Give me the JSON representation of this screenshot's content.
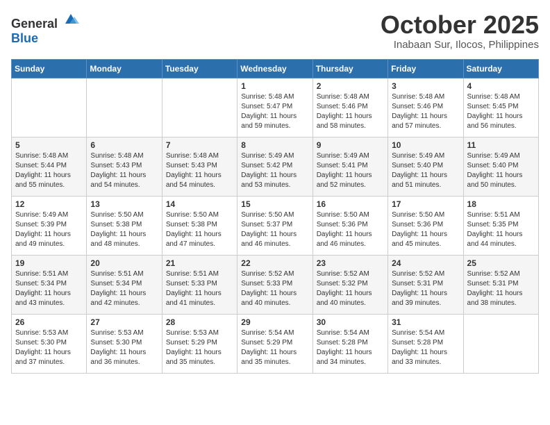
{
  "header": {
    "logo": {
      "text_general": "General",
      "text_blue": "Blue"
    },
    "title": "October 2025",
    "subtitle": "Inabaan Sur, Ilocos, Philippines"
  },
  "weekdays": [
    "Sunday",
    "Monday",
    "Tuesday",
    "Wednesday",
    "Thursday",
    "Friday",
    "Saturday"
  ],
  "weeks": [
    [
      {
        "day": "",
        "info": ""
      },
      {
        "day": "",
        "info": ""
      },
      {
        "day": "",
        "info": ""
      },
      {
        "day": "1",
        "info": "Sunrise: 5:48 AM\nSunset: 5:47 PM\nDaylight: 11 hours\nand 59 minutes."
      },
      {
        "day": "2",
        "info": "Sunrise: 5:48 AM\nSunset: 5:46 PM\nDaylight: 11 hours\nand 58 minutes."
      },
      {
        "day": "3",
        "info": "Sunrise: 5:48 AM\nSunset: 5:46 PM\nDaylight: 11 hours\nand 57 minutes."
      },
      {
        "day": "4",
        "info": "Sunrise: 5:48 AM\nSunset: 5:45 PM\nDaylight: 11 hours\nand 56 minutes."
      }
    ],
    [
      {
        "day": "5",
        "info": "Sunrise: 5:48 AM\nSunset: 5:44 PM\nDaylight: 11 hours\nand 55 minutes."
      },
      {
        "day": "6",
        "info": "Sunrise: 5:48 AM\nSunset: 5:43 PM\nDaylight: 11 hours\nand 54 minutes."
      },
      {
        "day": "7",
        "info": "Sunrise: 5:48 AM\nSunset: 5:43 PM\nDaylight: 11 hours\nand 54 minutes."
      },
      {
        "day": "8",
        "info": "Sunrise: 5:49 AM\nSunset: 5:42 PM\nDaylight: 11 hours\nand 53 minutes."
      },
      {
        "day": "9",
        "info": "Sunrise: 5:49 AM\nSunset: 5:41 PM\nDaylight: 11 hours\nand 52 minutes."
      },
      {
        "day": "10",
        "info": "Sunrise: 5:49 AM\nSunset: 5:40 PM\nDaylight: 11 hours\nand 51 minutes."
      },
      {
        "day": "11",
        "info": "Sunrise: 5:49 AM\nSunset: 5:40 PM\nDaylight: 11 hours\nand 50 minutes."
      }
    ],
    [
      {
        "day": "12",
        "info": "Sunrise: 5:49 AM\nSunset: 5:39 PM\nDaylight: 11 hours\nand 49 minutes."
      },
      {
        "day": "13",
        "info": "Sunrise: 5:50 AM\nSunset: 5:38 PM\nDaylight: 11 hours\nand 48 minutes."
      },
      {
        "day": "14",
        "info": "Sunrise: 5:50 AM\nSunset: 5:38 PM\nDaylight: 11 hours\nand 47 minutes."
      },
      {
        "day": "15",
        "info": "Sunrise: 5:50 AM\nSunset: 5:37 PM\nDaylight: 11 hours\nand 46 minutes."
      },
      {
        "day": "16",
        "info": "Sunrise: 5:50 AM\nSunset: 5:36 PM\nDaylight: 11 hours\nand 46 minutes."
      },
      {
        "day": "17",
        "info": "Sunrise: 5:50 AM\nSunset: 5:36 PM\nDaylight: 11 hours\nand 45 minutes."
      },
      {
        "day": "18",
        "info": "Sunrise: 5:51 AM\nSunset: 5:35 PM\nDaylight: 11 hours\nand 44 minutes."
      }
    ],
    [
      {
        "day": "19",
        "info": "Sunrise: 5:51 AM\nSunset: 5:34 PM\nDaylight: 11 hours\nand 43 minutes."
      },
      {
        "day": "20",
        "info": "Sunrise: 5:51 AM\nSunset: 5:34 PM\nDaylight: 11 hours\nand 42 minutes."
      },
      {
        "day": "21",
        "info": "Sunrise: 5:51 AM\nSunset: 5:33 PM\nDaylight: 11 hours\nand 41 minutes."
      },
      {
        "day": "22",
        "info": "Sunrise: 5:52 AM\nSunset: 5:33 PM\nDaylight: 11 hours\nand 40 minutes."
      },
      {
        "day": "23",
        "info": "Sunrise: 5:52 AM\nSunset: 5:32 PM\nDaylight: 11 hours\nand 40 minutes."
      },
      {
        "day": "24",
        "info": "Sunrise: 5:52 AM\nSunset: 5:31 PM\nDaylight: 11 hours\nand 39 minutes."
      },
      {
        "day": "25",
        "info": "Sunrise: 5:52 AM\nSunset: 5:31 PM\nDaylight: 11 hours\nand 38 minutes."
      }
    ],
    [
      {
        "day": "26",
        "info": "Sunrise: 5:53 AM\nSunset: 5:30 PM\nDaylight: 11 hours\nand 37 minutes."
      },
      {
        "day": "27",
        "info": "Sunrise: 5:53 AM\nSunset: 5:30 PM\nDaylight: 11 hours\nand 36 minutes."
      },
      {
        "day": "28",
        "info": "Sunrise: 5:53 AM\nSunset: 5:29 PM\nDaylight: 11 hours\nand 35 minutes."
      },
      {
        "day": "29",
        "info": "Sunrise: 5:54 AM\nSunset: 5:29 PM\nDaylight: 11 hours\nand 35 minutes."
      },
      {
        "day": "30",
        "info": "Sunrise: 5:54 AM\nSunset: 5:28 PM\nDaylight: 11 hours\nand 34 minutes."
      },
      {
        "day": "31",
        "info": "Sunrise: 5:54 AM\nSunset: 5:28 PM\nDaylight: 11 hours\nand 33 minutes."
      },
      {
        "day": "",
        "info": ""
      }
    ]
  ]
}
